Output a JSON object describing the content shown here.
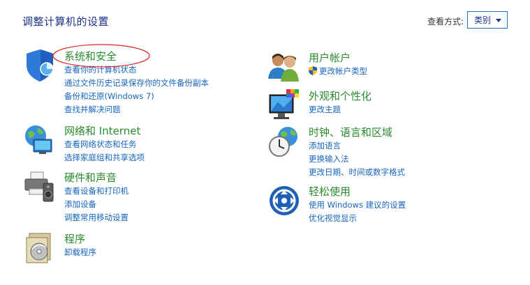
{
  "header": {
    "title": "调整计算机的设置",
    "view_by_label": "查看方式:",
    "view_by_value": "类别"
  },
  "categories": [
    {
      "id": "system-security",
      "title": "系统和安全",
      "icon": "shield-pie-icon",
      "links": [
        "查看你的计算机状态",
        "通过文件历史记录保存你的文件备份副本",
        "备份和还原(Windows 7)",
        "查找并解决问题"
      ]
    },
    {
      "id": "network-internet",
      "title": "网络和 Internet",
      "icon": "globe-network-icon",
      "links": [
        "查看网络状态和任务",
        "选择家庭组和共享选项"
      ]
    },
    {
      "id": "hardware-sound",
      "title": "硬件和声音",
      "icon": "printer-speaker-icon",
      "links": [
        "查看设备和打印机",
        "添加设备",
        "调整常用移动设置"
      ]
    },
    {
      "id": "programs",
      "title": "程序",
      "icon": "programs-disc-icon",
      "links": [
        "卸载程序"
      ]
    },
    {
      "id": "user-accounts",
      "title": "用户帐户",
      "icon": "users-icon",
      "links": [
        "更改帐户类型"
      ],
      "first_link_icon": "uac-shield-icon"
    },
    {
      "id": "appearance",
      "title": "外观和个性化",
      "icon": "monitor-palette-icon",
      "links": [
        "更改主题"
      ]
    },
    {
      "id": "clock-language-region",
      "title": "时钟、语言和区域",
      "icon": "clock-globe-icon",
      "links": [
        "添加语言",
        "更换输入法",
        "更改日期、时间或数字格式"
      ]
    },
    {
      "id": "ease-of-access",
      "title": "轻松使用",
      "icon": "ease-of-access-icon",
      "links": [
        "使用 Windows 建议的设置",
        "优化视觉显示"
      ]
    }
  ],
  "colors": {
    "title": "#1e3287",
    "category_title": "#2a8a2e",
    "link": "#1565c0",
    "annotation_circle": "#e02020"
  }
}
